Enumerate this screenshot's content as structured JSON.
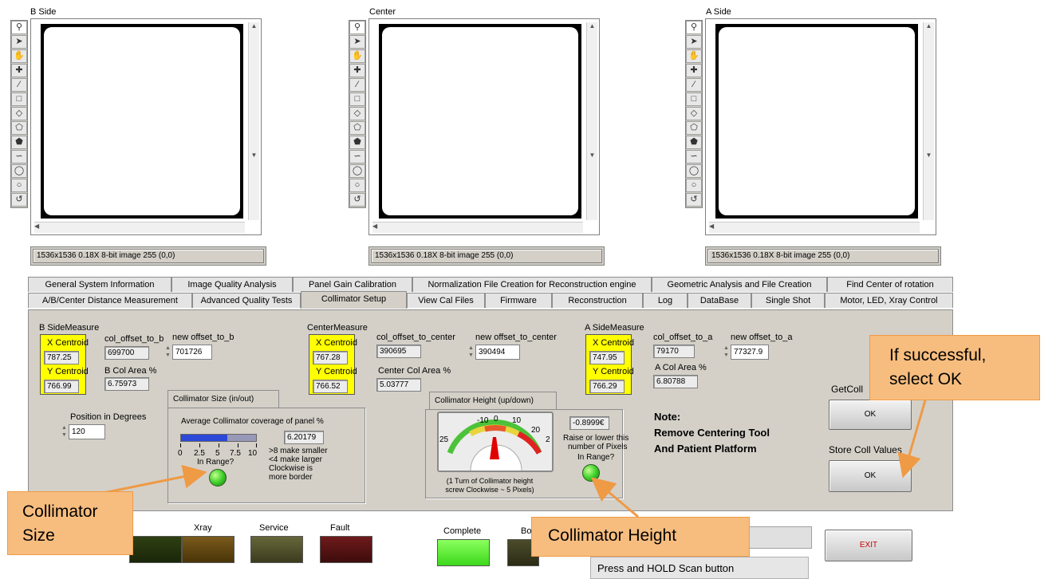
{
  "viewers": [
    {
      "title": "B Side",
      "status": "1536x1536 0.18X 8-bit image 255   (0,0)"
    },
    {
      "title": "Center",
      "status": "1536x1536 0.18X 8-bit image 255   (0,0)"
    },
    {
      "title": "A Side",
      "status": "1536x1536 0.18X 8-bit image 255   (0,0)"
    }
  ],
  "tools": [
    "search-icon",
    "arrow-icon",
    "hand-icon",
    "crosshair-icon",
    "line-icon",
    "rectangle-icon",
    "diamond-icon",
    "polygon-icon",
    "pentagon-icon",
    "freehand-icon",
    "free-polygon-icon",
    "circle-icon",
    "spiral-icon"
  ],
  "tabs_row1": [
    "General System Information",
    "Image Quality Analysis",
    "Panel Gain Calibration",
    "Normalization File Creation for Reconstruction engine",
    "Geometric Analysis and File Creation",
    "Find Center of rotation"
  ],
  "tabs_row2": [
    "A/B/Center Distance Measurement",
    "Advanced Quality Tests",
    "Collimator Setup",
    "View Cal Files",
    "Firmware",
    "Reconstruction",
    "Log",
    "DataBase",
    "Single Shot",
    "Motor, LED, Xray Control"
  ],
  "panel": {
    "b": {
      "measure_label": "B SideMeasure",
      "x_label": "X Centroid",
      "x_value": "787.25",
      "y_label": "Y Centroid",
      "y_value": "766.99",
      "offset_label": "col_offset_to_b",
      "offset_value": "699700",
      "new_offset_label": "new offset_to_b",
      "new_offset_value": "701726",
      "area_label": "B Col Area %",
      "area_value": "6.75973"
    },
    "c": {
      "measure_label": "CenterMeasure",
      "x_label": "X Centroid",
      "x_value": "767.28",
      "y_label": "Y Centroid",
      "y_value": "766.52",
      "offset_label": "col_offset_to_center",
      "offset_value": "390695",
      "new_offset_label": "new offset_to_center",
      "new_offset_value": "390494",
      "area_label": "Center Col Area %",
      "area_value": "5.03777"
    },
    "a": {
      "measure_label": "A SideMeasure",
      "x_label": "X Centroid",
      "x_value": "747.95",
      "y_label": "Y Centroid",
      "y_value": "766.29",
      "offset_label": "col_offset_to_a",
      "offset_value": "79170",
      "new_offset_label": "new offset_to_a",
      "new_offset_value": "77327.9",
      "area_label": "A Col Area %",
      "area_value": "6.80788"
    },
    "position": {
      "label": "Position in Degrees",
      "value": "120"
    },
    "size": {
      "title": "Collimator Size (in/out)",
      "coverage_label": "Average Collimator coverage of panel %",
      "coverage_value": "6.20179",
      "fraction": 0.62,
      "ticks": [
        "0",
        "2.5",
        "5",
        "7.5",
        "10"
      ],
      "hint1": ">8 make smaller",
      "hint2": "<4 make larger",
      "hint3": "Clockwise is",
      "hint4": "more border",
      "range_label": "In Range?"
    },
    "height": {
      "title": "Collimator Height (up/down)",
      "value": "-0.8999€",
      "ticks": [
        "-10",
        "0",
        "10",
        "20"
      ],
      "tick_left": "25",
      "tick_right": "2",
      "desc1": "Raise or lower  this",
      "desc2": "number  of Pixels",
      "range_label": "In Range?",
      "note1": "(1 Turn of Collimator height",
      "note2": "screw Clockwise ~ 5 Pixels)"
    },
    "note": {
      "l1": "Note:",
      "l2": "Remove Centering Tool",
      "l3": "And Patient Platform"
    },
    "get_label": "GetColl",
    "ok_label": "OK",
    "store_label": "Store Coll Values"
  },
  "bottom": {
    "labels": [
      "Xray",
      "Service",
      "Fault",
      "Complete",
      "Bo"
    ],
    "status_message": "Press and HOLD Scan button",
    "exit_label": "EXIT"
  },
  "callouts": {
    "success_l1": "If successful,",
    "success_l2": "select OK",
    "size_l1": "Collimator",
    "size_l2": "Size",
    "height": "Collimator Height"
  },
  "colors": {
    "indicator_yellow": "#ffff00",
    "led_green": "#3fd12c",
    "callout_fill": "#f7bd7f",
    "exit_text": "#cc0000"
  }
}
